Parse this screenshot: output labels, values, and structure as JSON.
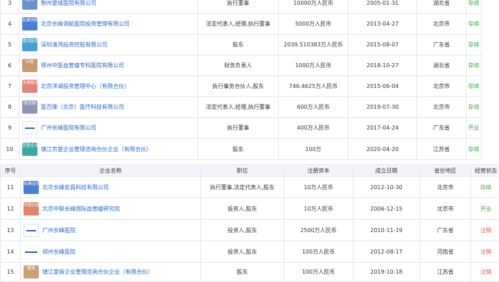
{
  "header": {
    "index": "序号",
    "company": "企业名称",
    "position": "职位",
    "capital": "注册资本",
    "date": "成立日期",
    "region": "省份地区",
    "status": "经营状态"
  },
  "table1": [
    {
      "idx": "3",
      "logo_text": "医院",
      "logo_color": "#6a8fd0",
      "name": "荆州楚城医院有限公司",
      "position": "执行董事",
      "capital": "10000万人民币",
      "date": "2005-01-31",
      "region": "湖北省",
      "status": "存续"
    },
    {
      "idx": "4",
      "logo_text": "长峰领航",
      "logo_color": "#4a7fd6",
      "name": "北京长峰领航医院投资管理有限公司",
      "position": "法定代表人,经理,执行董事",
      "capital": "5000万人民币",
      "date": "2013-04-27",
      "region": "北京市",
      "status": "存续"
    },
    {
      "idx": "5",
      "logo_text": "清鸿投资",
      "logo_color": "#4aa0cc",
      "name": "深圳清鸿投资控股有限公司",
      "position": "股东",
      "capital": "2039.510383万人民币",
      "date": "2015-08-07",
      "region": "广东省",
      "status": "存续"
    },
    {
      "idx": "6",
      "logo_text": "中医",
      "logo_color": "#c79a74",
      "name": "鄂州中医血管瘤专科医院有限公司",
      "position": "财务负责人",
      "capital": "1000万人民币",
      "date": "2018-10-27",
      "region": "湖北省",
      "status": "存续"
    },
    {
      "idx": "7",
      "logo_text": "洋澜投资",
      "logo_color": "#e2857a",
      "name": "北京洋澜投资管理中心（有限合伙）",
      "position": "执行事务合伙人,股东",
      "capital": "746.4625万人民币",
      "date": "2015-06-04",
      "region": "北京市",
      "status": "存续"
    },
    {
      "idx": "8",
      "logo_text": "医百顺",
      "logo_color": "#8c94b8",
      "name": "医百顺（北京）医疗科技有限公司",
      "position": "法定代表人,经理,执行董事",
      "capital": "600万人民币",
      "date": "2019-07-30",
      "region": "北京市",
      "status": "存续"
    },
    {
      "idx": "9",
      "logo_text": "",
      "logo_color": "#ffffff",
      "name": "广州长峰医院有限公司",
      "position": "执行董事",
      "capital": "400万人民币",
      "date": "2017-04-24",
      "region": "广东省",
      "status": "开业"
    },
    {
      "idx": "10",
      "logo_text": "京楚企业",
      "logo_color": "#3aa8a0",
      "name": "镇江京楚企业管理咨询合伙企业（有限合伙）",
      "position": "股东",
      "capital": "100万",
      "date": "2020-04-20",
      "region": "江苏省",
      "status": "存续"
    }
  ],
  "table2": [
    {
      "idx": "11",
      "logo_text": "长峰宏昌",
      "logo_color": "#4a7fd6",
      "name": "北京长峰宏昌科技有限公司",
      "position": "执行董事,法定代表人,股东",
      "capital": "10万人民币",
      "date": "2012-10-30",
      "region": "北京市",
      "status": "存续"
    },
    {
      "idx": "12",
      "logo_text": "中联长峰",
      "logo_color": "#e0836e",
      "name": "北京中联长峰国际血管瘤研究院",
      "position": "投资人,股东",
      "capital": "10万人民币",
      "date": "2006-12-15",
      "region": "北京市",
      "status": "开业"
    },
    {
      "idx": "13",
      "logo_text": "",
      "logo_color": "#ffffff",
      "name": "广州长峰医院",
      "position": "投资人,股东",
      "capital": "2500万人民币",
      "date": "2010-11-19",
      "region": "广东省",
      "status": "注销"
    },
    {
      "idx": "14",
      "logo_text": "",
      "logo_color": "#ffffff",
      "name": "郑州长峰医院",
      "position": "投资人,股东",
      "capital": "100万人民币",
      "date": "2012-08-17",
      "region": "河南省",
      "status": "注销"
    },
    {
      "idx": "15",
      "logo_text": "楚商",
      "logo_color": "#c9a078",
      "name": "镇江楚商企业管理咨询合伙企业（有限合伙）",
      "position": "股东",
      "capital": "100万人民币",
      "date": "2019-10-18",
      "region": "江苏省",
      "status": "注销"
    }
  ]
}
